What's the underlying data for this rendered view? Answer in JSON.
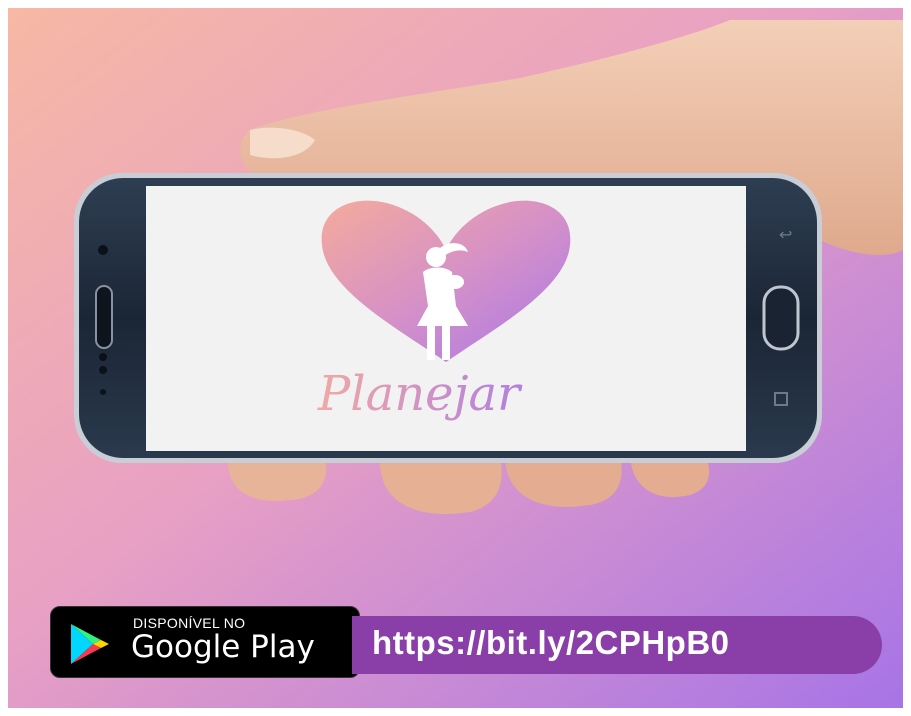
{
  "app": {
    "name": "Planejar"
  },
  "store_badge": {
    "small_label": "DISPONÍVEL NO",
    "big_label": "Google Play"
  },
  "link": {
    "url": "https://bit.ly/2CPHpB0"
  },
  "colors": {
    "bg_top_left": "#f6b7a5",
    "bg_bottom_right": "#a878e6",
    "heart_top": "#f3a9a0",
    "heart_bottom": "#a879e8",
    "phone_body": "#1f2c3d",
    "pill": "#8a3fa8"
  }
}
